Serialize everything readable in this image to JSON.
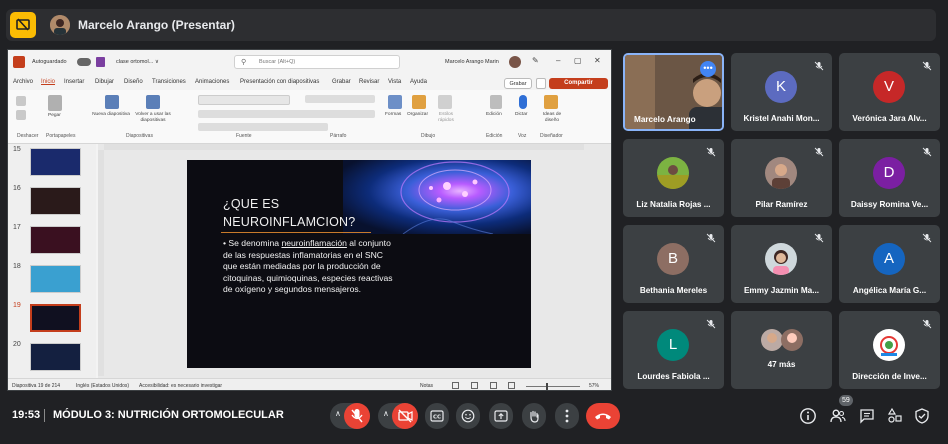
{
  "presenter_bar": {
    "title": "Marcelo Arango (Presentar)"
  },
  "ppt": {
    "autosave_label": "Autoguardado",
    "file_name": "clase ortomol... ∨",
    "search_placeholder": "Buscar (Alt+Q)",
    "user_name": "Marcelo Arango Marin",
    "menu": [
      "Archivo",
      "Inicio",
      "Insertar",
      "Dibujar",
      "Diseño",
      "Transiciones",
      "Animaciones",
      "Presentación con diapositivas",
      "Grabar",
      "Revisar",
      "Vista",
      "Ayuda"
    ],
    "grabar_label": "Grabar",
    "compartir_label": "Compartir",
    "ribbon_groups": [
      "Deshacer",
      "Portapapeles",
      "Diapositivas",
      "Fuente",
      "Párrafo",
      "Dibujo",
      "Edición",
      "Voz",
      "Diseñador"
    ],
    "ribbon_buttons": {
      "paste": "Pegar",
      "new_slide": "Nueva diapositiva",
      "reuse_slides": "Volver a usar las diapositivas",
      "shapes": "Formas",
      "arrange": "Organizar",
      "quick_styles": "Estilos rápidos",
      "editing": "Edición",
      "dictate": "Dictar",
      "design_ideas": "Ideas de diseño"
    },
    "slide_numbers": [
      "15",
      "16",
      "17",
      "18",
      "19",
      "20"
    ],
    "slide": {
      "title_line1": "¿QUE ES",
      "title_line2": "NEUROINFLAMCION?",
      "bullet_prefix": "• Se denomina ",
      "bullet_term": "neuroinflamación",
      "bullet_rest": " al conjunto de las respuestas inflamatorias en el SNC que están mediadas por la producción de citoquinas, quimioquinas, especies reactivas de oxígeno y segundos mensajeros."
    },
    "status": {
      "slide_count": "Diapositiva 19 de 214",
      "language": "Inglés (Estados Unidos)",
      "accessibility": "Accesibilidad: es necesario investigar",
      "notes": "Notas",
      "zoom": "57%"
    }
  },
  "participants": [
    {
      "name": "Marcelo Arango",
      "type": "photo",
      "highlight": true
    },
    {
      "name": "Kristel Anahi Mon...",
      "initial": "K",
      "color": "#5c6bc0"
    },
    {
      "name": "Verónica Jara Alv...",
      "initial": "V",
      "color": "#c62828"
    },
    {
      "name": "Liz Natalia Rojas ...",
      "type": "photo"
    },
    {
      "name": "Pilar Ramírez",
      "type": "photo"
    },
    {
      "name": "Daissy Romina Ve...",
      "initial": "D",
      "color": "#7b1fa2"
    },
    {
      "name": "Bethania Mereles",
      "initial": "B",
      "color": "#8d6e63"
    },
    {
      "name": "Emmy Jazmin Ma...",
      "type": "photo"
    },
    {
      "name": "Angélica María G...",
      "initial": "A",
      "color": "#1565c0"
    },
    {
      "name": "Lourdes Fabiola ...",
      "initial": "L",
      "color": "#00897b"
    },
    {
      "name": "47 más",
      "type": "group"
    },
    {
      "name": "Dirección de Inve...",
      "type": "logo"
    }
  ],
  "bottom": {
    "time": "19:53",
    "meeting_title": "MÓDULO 3: NUTRICIÓN ORTOMOLECULAR",
    "participant_count": "59"
  },
  "colors": {
    "background": "#202124",
    "tile": "#3c4043",
    "danger": "#ea4335",
    "present_icon": "#fbbc04",
    "ppt_accent": "#c43e1c"
  }
}
